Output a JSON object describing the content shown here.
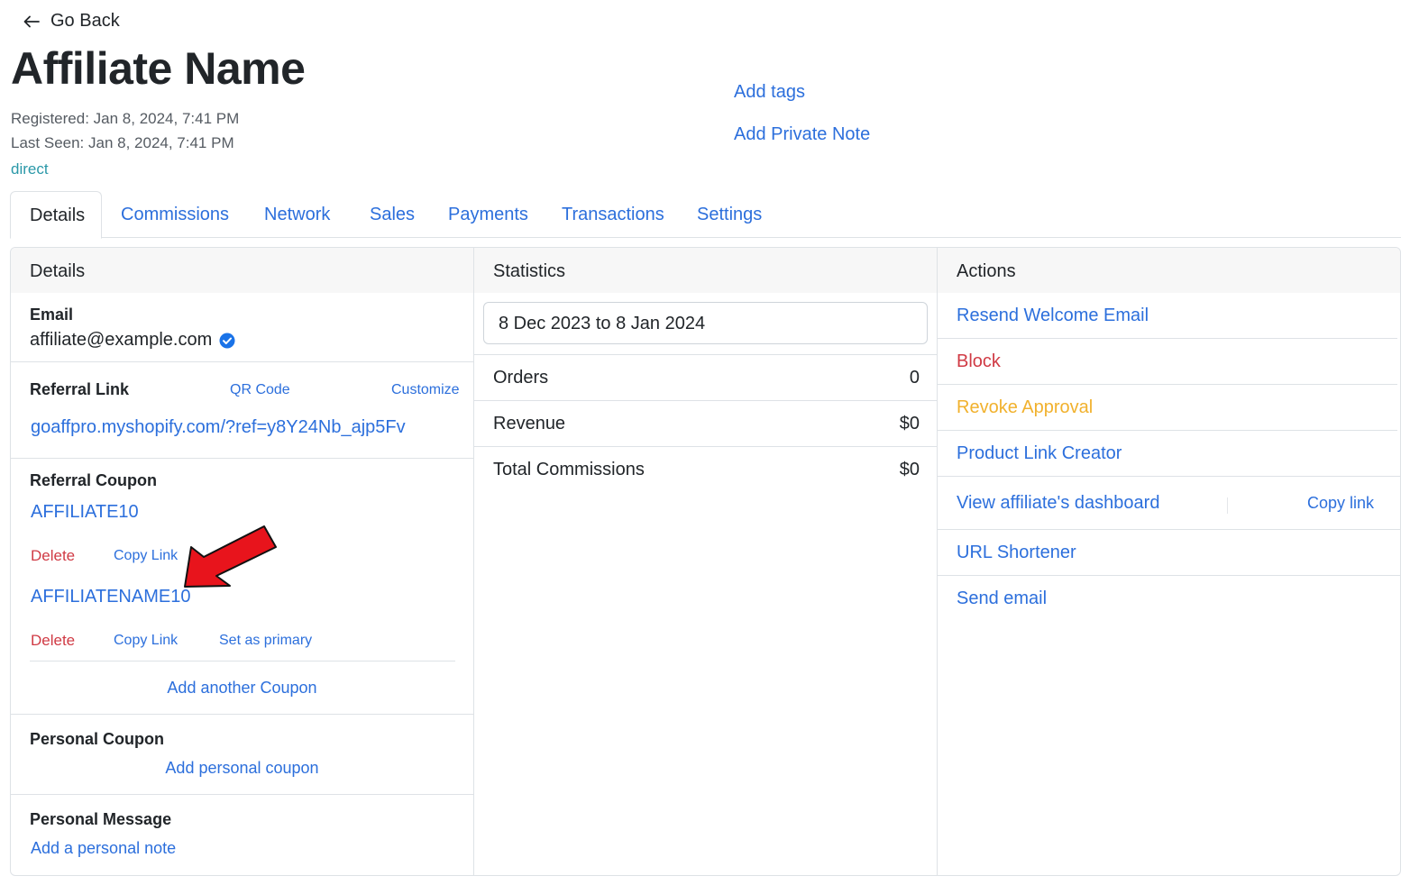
{
  "nav": {
    "go_back": "Go Back"
  },
  "header": {
    "title": "Affiliate Name",
    "registered": "Registered: Jan 8, 2024, 7:41 PM",
    "last_seen": "Last Seen: Jan 8, 2024, 7:41 PM",
    "source": "direct",
    "add_tags": "Add tags",
    "add_private_note": "Add Private Note"
  },
  "tabs": [
    {
      "label": "Details",
      "active": true
    },
    {
      "label": "Commissions"
    },
    {
      "label": "Network"
    },
    {
      "label": "Sales"
    },
    {
      "label": "Payments"
    },
    {
      "label": "Transactions"
    },
    {
      "label": "Settings"
    }
  ],
  "details": {
    "header": "Details",
    "email_label": "Email",
    "email": "affiliate@example.com",
    "referral_link_label": "Referral Link",
    "qr_code": "QR Code",
    "customize": "Customize",
    "referral_link": "goaffpro.myshopify.com/?ref=y8Y24Nb_ajp5Fv",
    "referral_coupon_label": "Referral Coupon",
    "coupons": [
      {
        "code": "AFFILIATE10",
        "delete": "Delete",
        "copy": "Copy Link"
      },
      {
        "code": "AFFILIATENAME10",
        "delete": "Delete",
        "copy": "Copy Link",
        "primary": "Set as primary"
      }
    ],
    "add_another_coupon": "Add another Coupon",
    "personal_coupon_label": "Personal Coupon",
    "add_personal_coupon": "Add personal coupon",
    "personal_message_label": "Personal Message",
    "add_personal_note": "Add a personal note"
  },
  "statistics": {
    "header": "Statistics",
    "date_range": "8 Dec 2023 to 8 Jan 2024",
    "rows": [
      {
        "name": "Orders",
        "value": "0"
      },
      {
        "name": "Revenue",
        "value": "$0"
      },
      {
        "name": "Total Commissions",
        "value": "$0"
      }
    ]
  },
  "actions": {
    "header": "Actions",
    "resend_welcome": "Resend Welcome Email",
    "block": "Block",
    "revoke_approval": "Revoke Approval",
    "product_link_creator": "Product Link Creator",
    "view_dashboard": "View affiliate's dashboard",
    "copy_link": "Copy link",
    "url_shortener": "URL Shortener",
    "send_email": "Send email"
  },
  "colors": {
    "link": "#2c6fdc",
    "danger": "#d03a44",
    "warning": "#f1b12d",
    "teal": "#2a98a8",
    "verified": "#1a73e8",
    "annotation_arrow": "#e8141c"
  }
}
